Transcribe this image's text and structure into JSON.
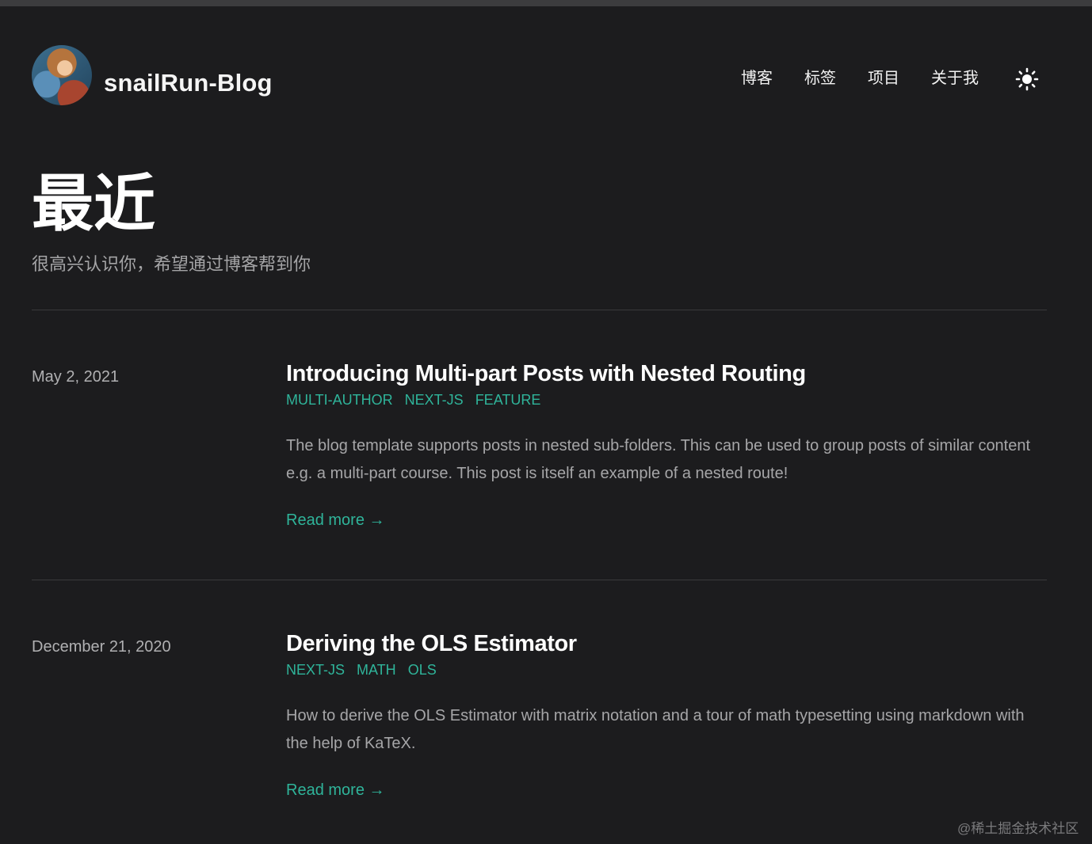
{
  "header": {
    "site_title": "snailRun-Blog",
    "nav": [
      {
        "label": "博客"
      },
      {
        "label": "标签"
      },
      {
        "label": "项目"
      },
      {
        "label": "关于我"
      }
    ],
    "theme_toggle_icon": "sun-icon"
  },
  "page": {
    "title": "最近",
    "subtitle": "很高兴认识你，希望通过博客帮到你"
  },
  "posts": [
    {
      "date": "May 2, 2021",
      "title": "Introducing Multi-part Posts with Nested Routing",
      "tags": [
        "MULTI-AUTHOR",
        "NEXT-JS",
        "FEATURE"
      ],
      "excerpt": "The blog template supports posts in nested sub-folders. This can be used to group posts of similar content e.g. a multi-part course. This post is itself an example of a nested route!",
      "read_more": "Read more →"
    },
    {
      "date": "December 21, 2020",
      "title": "Deriving the OLS Estimator",
      "tags": [
        "NEXT-JS",
        "MATH",
        "OLS"
      ],
      "excerpt": "How to derive the OLS Estimator with matrix notation and a tour of math typesetting using markdown with the help of KaTeX.",
      "read_more": "Read more →"
    }
  ],
  "watermark": "@稀土掘金技术社区",
  "colors": {
    "background": "#1c1c1e",
    "accent": "#2fb49a",
    "text": "#ffffff",
    "muted": "#a6a6a8"
  }
}
